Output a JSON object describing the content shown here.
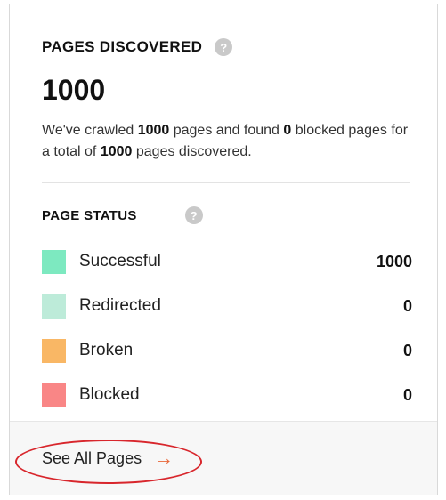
{
  "pages_discovered": {
    "title": "PAGES DISCOVERED",
    "help": "?",
    "total": "1000",
    "summary_parts": [
      "We've crawled ",
      "1000",
      " pages and found ",
      "0",
      " blocked pages for a total of ",
      "1000",
      " pages discovered."
    ]
  },
  "page_status": {
    "title": "PAGE STATUS",
    "help": "?",
    "items": [
      {
        "label": "Successful",
        "value": "1000",
        "color": "#7de9c0"
      },
      {
        "label": "Redirected",
        "value": "0",
        "color": "#bdebd9"
      },
      {
        "label": "Broken",
        "value": "0",
        "color": "#f9b765"
      },
      {
        "label": "Blocked",
        "value": "0",
        "color": "#f98686"
      }
    ]
  },
  "footer": {
    "link_label": "See All Pages",
    "arrow": "→"
  },
  "colors": {
    "arrow": "#e8683a",
    "annotation": "#d8262c"
  }
}
